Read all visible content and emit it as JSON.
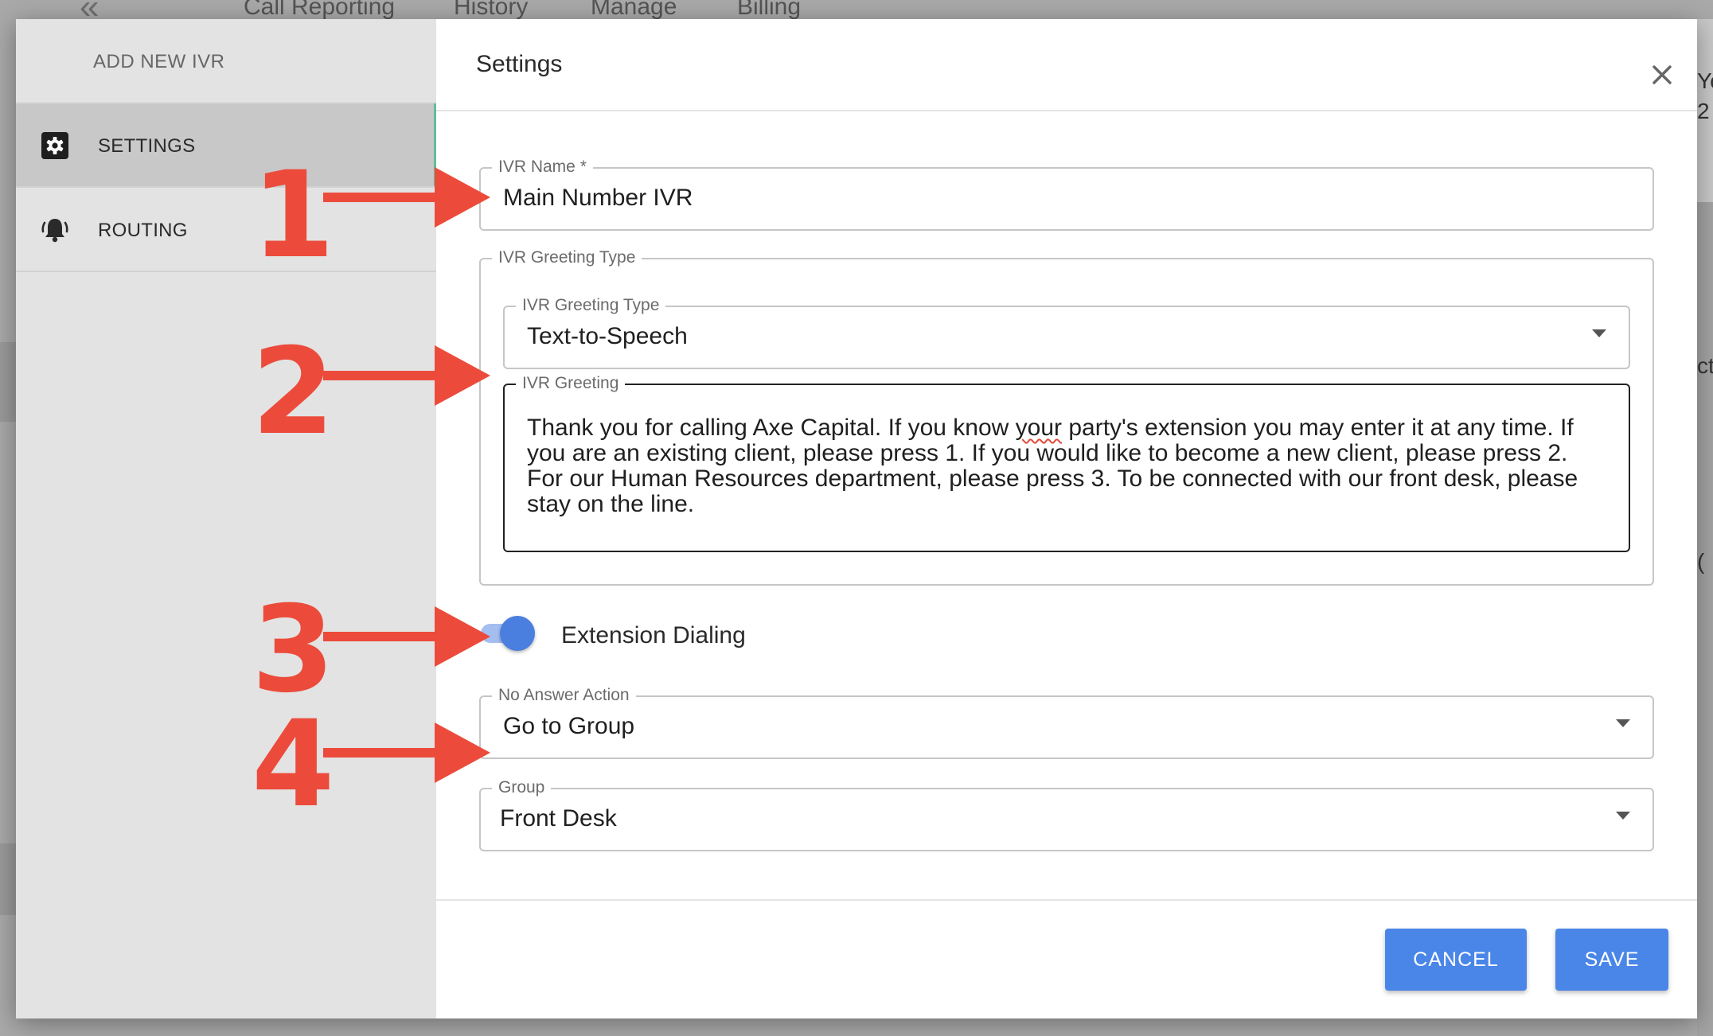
{
  "background_nav": {
    "back_glyph": "«",
    "tabs": [
      "Call Reporting",
      "History",
      "Manage",
      "Billing"
    ],
    "right_edge_fragments": [
      "Yo",
      "2",
      "ct",
      "("
    ]
  },
  "sidebar": {
    "title": "ADD NEW IVR",
    "items": [
      {
        "label": "SETTINGS",
        "icon": "gear-icon",
        "active": true
      },
      {
        "label": "ROUTING",
        "icon": "bell-icon",
        "active": false
      }
    ]
  },
  "modal": {
    "title": "Settings",
    "close_icon": "close-icon"
  },
  "form": {
    "ivr_name": {
      "label": "IVR Name *",
      "value": "Main Number IVR"
    },
    "greeting_section": {
      "label": "IVR Greeting Type"
    },
    "greeting_type": {
      "label": "IVR Greeting Type",
      "value": "Text-to-Speech"
    },
    "greeting": {
      "label": "IVR Greeting",
      "value_before": "Thank you for calling Axe Capital. If you know ",
      "value_flagged": "your",
      "value_after": " party's extension you may enter it at any time. If you are an existing client, please press 1. If you would like to become a new client, please press 2. For our Human Resources department, please press 3. To be connected with our front desk, please stay on the line."
    },
    "extension_dialing": {
      "label": "Extension Dialing",
      "enabled": true
    },
    "no_answer_action": {
      "label": "No Answer Action",
      "value": "Go to Group"
    },
    "group": {
      "label": "Group",
      "value": "Front Desk"
    }
  },
  "buttons": {
    "cancel": "CANCEL",
    "save": "SAVE"
  },
  "annotations": [
    "1",
    "2",
    "3",
    "4"
  ],
  "colors": {
    "primary_button": "#4a86e8",
    "toggle_knob": "#4a7fe0",
    "toggle_track": "#a4bef0",
    "annotation_red": "#ec4b3b",
    "active_indicator": "#5fbf9a"
  }
}
